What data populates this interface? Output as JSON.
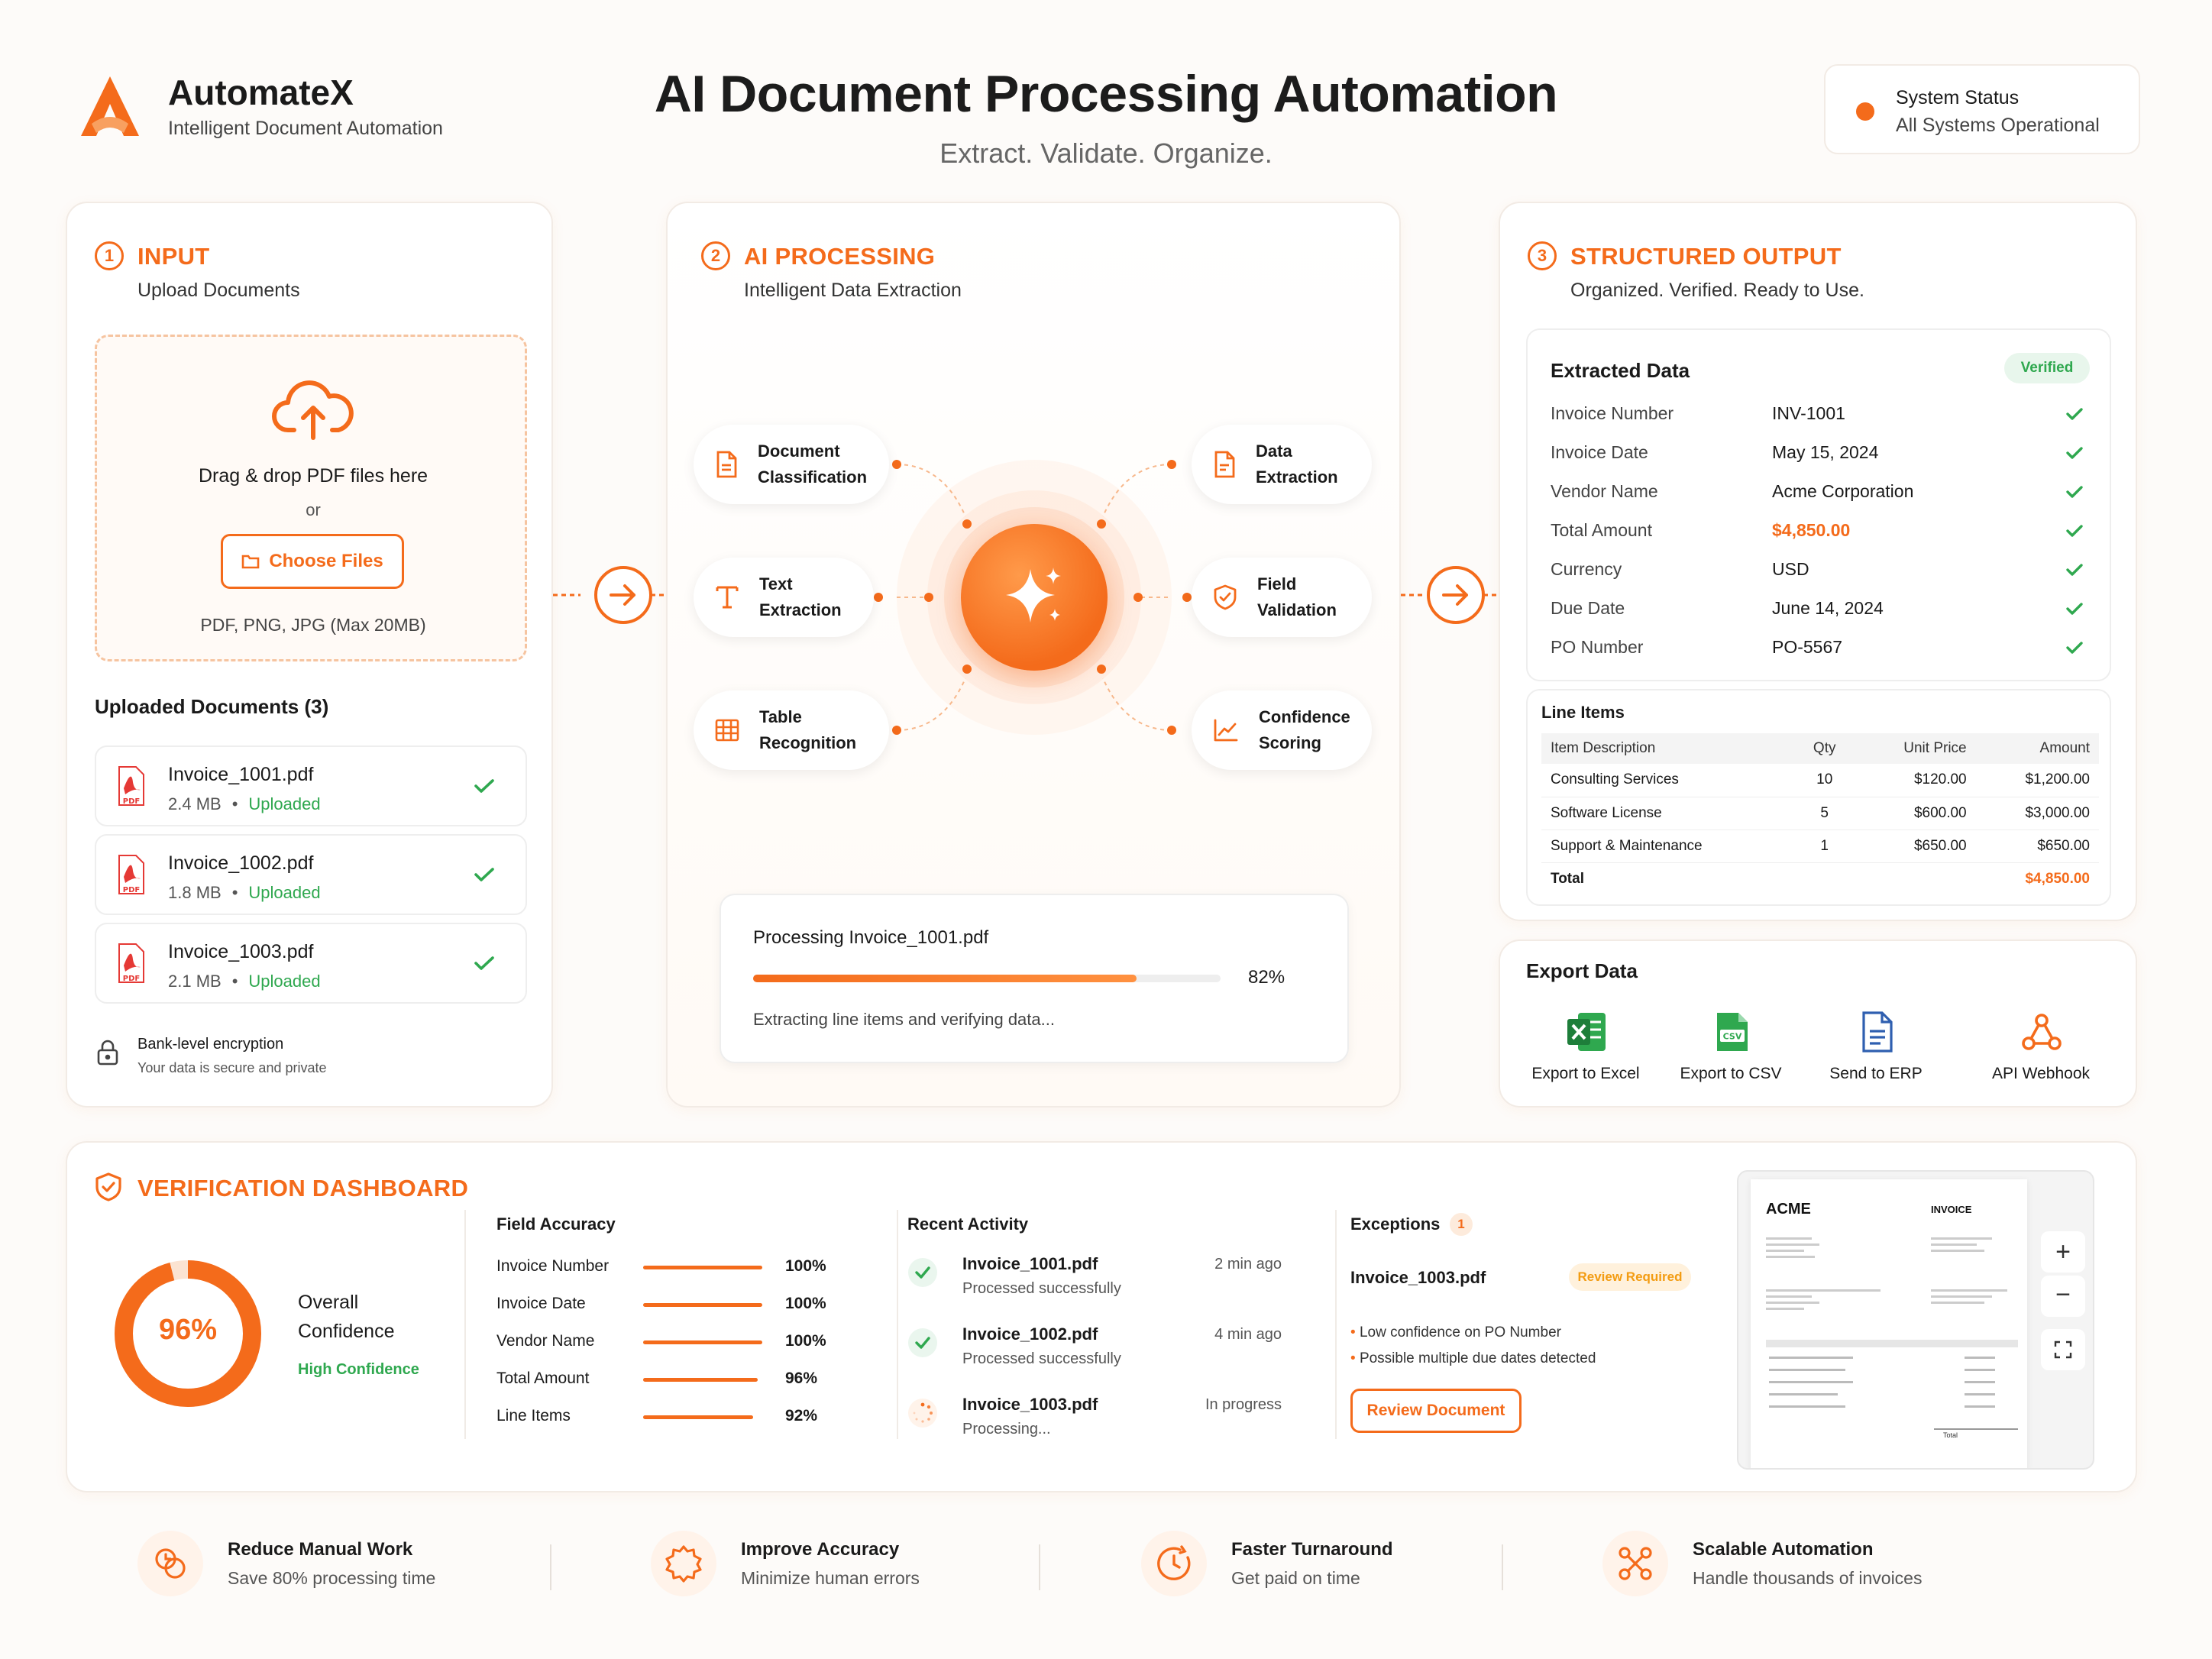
{
  "colors": {
    "accent": "#f46b1b",
    "success": "#2fa84f",
    "warning": "#f39c12"
  },
  "header": {
    "brand_name": "AutomateX",
    "brand_tagline": "Intelligent Document Automation",
    "title": "AI Document Processing Automation",
    "subtitle": "Extract. Validate. Organize.",
    "status_label": "System Status",
    "status_value": "All Systems Operational"
  },
  "input": {
    "step": "1",
    "title": "INPUT",
    "subtitle": "Upload Documents",
    "drop_text": "Drag & drop PDF files here",
    "or_text": "or",
    "choose_label": "Choose Files",
    "formats": "PDF, PNG, JPG (Max 20MB)",
    "uploaded_heading": "Uploaded Documents (3)",
    "files": [
      {
        "name": "Invoice_1001.pdf",
        "size": "2.4 MB",
        "status": "Uploaded"
      },
      {
        "name": "Invoice_1002.pdf",
        "size": "1.8 MB",
        "status": "Uploaded"
      },
      {
        "name": "Invoice_1003.pdf",
        "size": "2.1 MB",
        "status": "Uploaded"
      }
    ],
    "pdf_tag": "PDF",
    "security_title": "Bank-level encryption",
    "security_sub": "Your data is secure and private"
  },
  "processing": {
    "step": "2",
    "title": "AI PROCESSING",
    "subtitle": "Intelligent Data Extraction",
    "steps": {
      "doc_class": [
        "Document",
        "Classification"
      ],
      "text_ext": [
        "Text",
        "Extraction"
      ],
      "table_rec": [
        "Table",
        "Recognition"
      ],
      "data_ext": [
        "Data",
        "Extraction"
      ],
      "field_val": [
        "Field",
        "Validation"
      ],
      "conf_score": [
        "Confidence",
        "Scoring"
      ]
    },
    "progress_title": "Processing Invoice_1001.pdf",
    "progress_value": 0.82,
    "progress_label": "82%",
    "progress_status": "Extracting line items and verifying data..."
  },
  "output": {
    "step": "3",
    "title": "STRUCTURED OUTPUT",
    "subtitle": "Organized. Verified. Ready to Use.",
    "extracted_heading": "Extracted Data",
    "verified_badge": "Verified",
    "fields": [
      {
        "label": "Invoice Number",
        "value": "INV-1001"
      },
      {
        "label": "Invoice Date",
        "value": "May 15, 2024"
      },
      {
        "label": "Vendor Name",
        "value": "Acme Corporation"
      },
      {
        "label": "Total Amount",
        "value": "$4,850.00"
      },
      {
        "label": "Currency",
        "value": "USD"
      },
      {
        "label": "Due Date",
        "value": "June 14, 2024"
      },
      {
        "label": "PO Number",
        "value": "PO-5567"
      }
    ],
    "line_items_heading": "Line Items",
    "line_headers": [
      "Item Description",
      "Qty",
      "Unit Price",
      "Amount"
    ],
    "line_rows": [
      [
        "Consulting Services",
        "10",
        "$120.00",
        "$1,200.00"
      ],
      [
        "Software License",
        "5",
        "$600.00",
        "$3,000.00"
      ],
      [
        "Support & Maintenance",
        "1",
        "$650.00",
        "$650.00"
      ]
    ],
    "total_label": "Total",
    "total_value": "$4,850.00"
  },
  "export": {
    "heading": "Export Data",
    "excel": "Export to Excel",
    "csv": "Export to CSV",
    "csv_tag": "CSV",
    "erp": "Send to ERP",
    "webhook": "API Webhook"
  },
  "dashboard": {
    "title": "VERIFICATION DASHBOARD",
    "confidence_value": 0.96,
    "confidence_label": "96%",
    "confidence_title_1": "Overall",
    "confidence_title_2": "Confidence",
    "confidence_level": "High Confidence",
    "accuracy_heading": "Field Accuracy",
    "accuracy": [
      {
        "label": "Invoice Number",
        "value": 1.0,
        "text": "100%"
      },
      {
        "label": "Invoice Date",
        "value": 1.0,
        "text": "100%"
      },
      {
        "label": "Vendor Name",
        "value": 1.0,
        "text": "100%"
      },
      {
        "label": "Total Amount",
        "value": 0.96,
        "text": "96%"
      },
      {
        "label": "Line Items",
        "value": 0.92,
        "text": "92%"
      }
    ],
    "activity_heading": "Recent Activity",
    "activity": [
      {
        "name": "Invoice_1001.pdf",
        "status": "Processed successfully",
        "time": "2 min ago"
      },
      {
        "name": "Invoice_1002.pdf",
        "status": "Processed successfully",
        "time": "4 min ago"
      },
      {
        "name": "Invoice_1003.pdf",
        "status": "Processing...",
        "time": "In progress"
      }
    ],
    "exceptions_heading": "Exceptions",
    "exceptions_count": "1",
    "exception_file": "Invoice_1003.pdf",
    "exception_badge": "Review Required",
    "exception_reasons": [
      "Low confidence on PO Number",
      "Possible multiple due dates detected"
    ],
    "review_label": "Review Document",
    "preview_brand": "ACME",
    "preview_doc": "INVOICE",
    "preview_total": "Total"
  },
  "features": [
    {
      "title": "Reduce Manual Work",
      "sub": "Save 80% processing time"
    },
    {
      "title": "Improve Accuracy",
      "sub": "Minimize human errors"
    },
    {
      "title": "Faster Turnaround",
      "sub": "Get paid on time"
    },
    {
      "title": "Scalable Automation",
      "sub": "Handle thousands of invoices"
    }
  ]
}
